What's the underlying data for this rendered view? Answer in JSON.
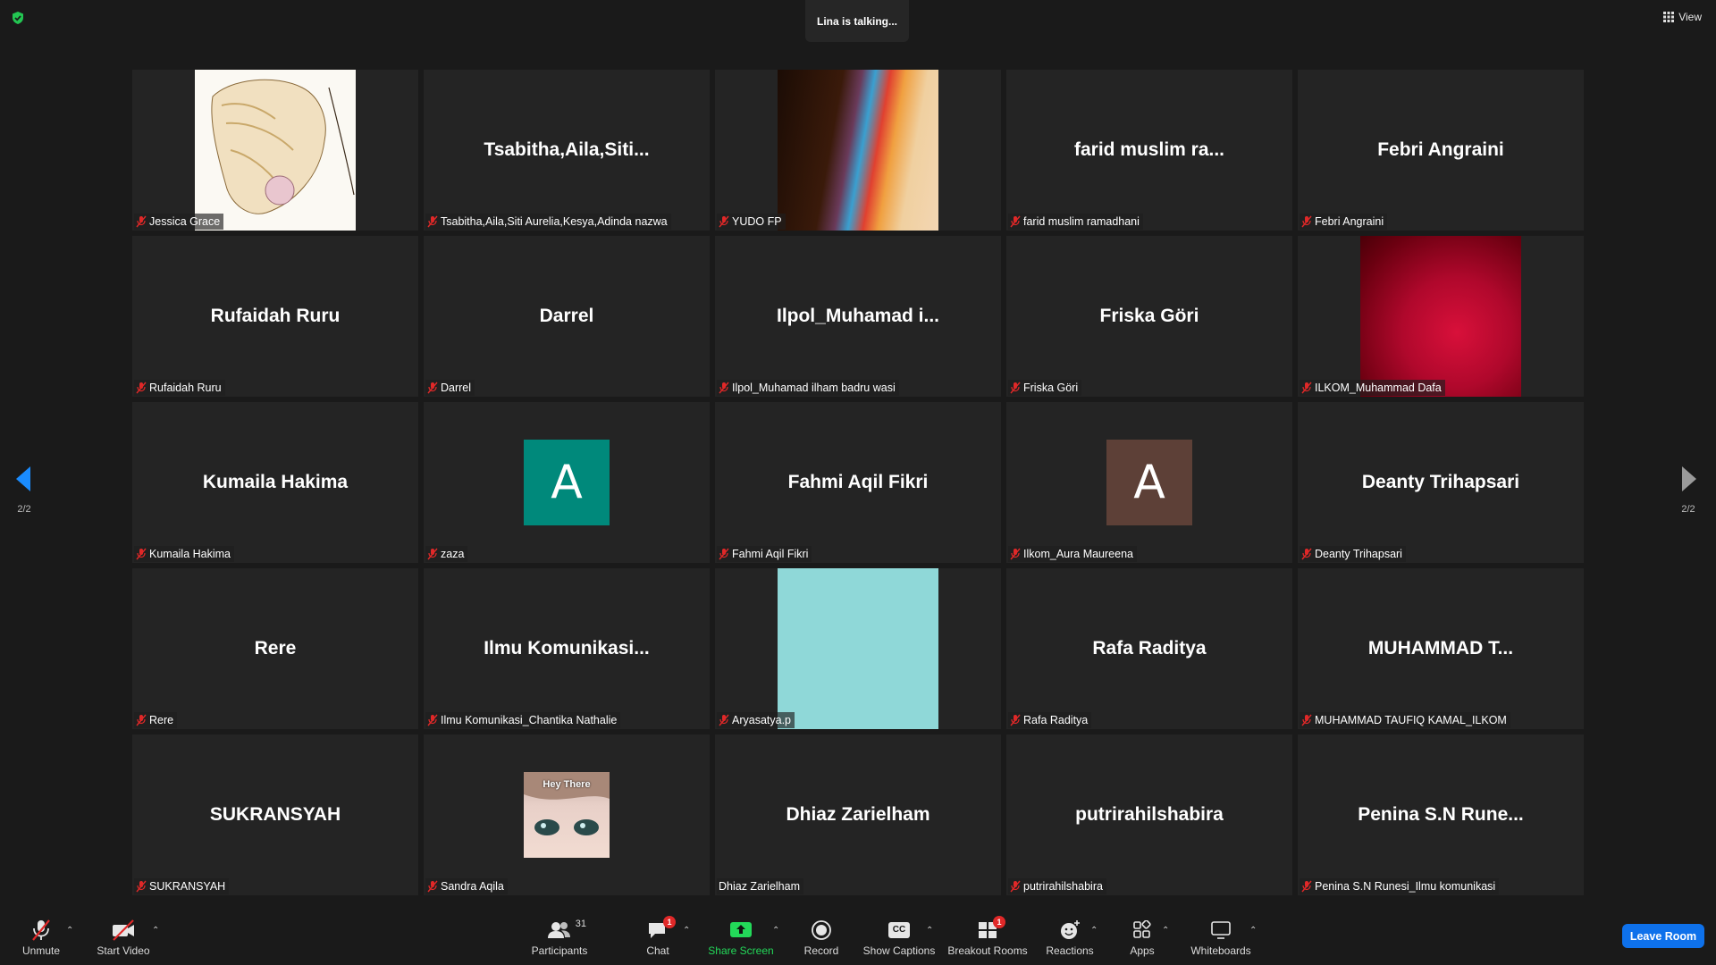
{
  "topbar": {
    "security_icon": "shield-check-icon",
    "talking_indicator": "Lina is talking...",
    "view_label": "View"
  },
  "pagination": {
    "left": "2/2",
    "right": "2/2"
  },
  "tiles": [
    {
      "display": "",
      "label": "Jessica Grace",
      "muted": true
    },
    {
      "display": "Tsabitha,Aila,Siti...",
      "label": "Tsabitha,Aila,Siti Aurelia,Kesya,Adinda nazwa",
      "muted": true
    },
    {
      "display": "",
      "label": "YUDO FP",
      "muted": true
    },
    {
      "display": "farid  muslim  ra...",
      "label": "farid muslim ramadhani",
      "muted": true
    },
    {
      "display": "Febri Angraini",
      "label": "Febri Angraini",
      "muted": true
    },
    {
      "display": "Rufaidah Ruru",
      "label": "Rufaidah Ruru",
      "muted": true
    },
    {
      "display": "Darrel",
      "label": "Darrel",
      "muted": true
    },
    {
      "display": "Ilpol_Muhamad  i...",
      "label": "Ilpol_Muhamad ilham badru wasi",
      "muted": true
    },
    {
      "display": "Friska Göri",
      "label": "Friska Göri",
      "muted": true
    },
    {
      "display": "",
      "label": "ILKOM_Muhammad Dafa",
      "muted": true
    },
    {
      "display": "Kumaila Hakima",
      "label": "Kumaila Hakima",
      "muted": true
    },
    {
      "display": "",
      "avatar": "A",
      "label": "zaza",
      "muted": true
    },
    {
      "display": "Fahmi Aqil Fikri",
      "label": "Fahmi Aqil Fikri",
      "muted": true
    },
    {
      "display": "",
      "avatar": "A",
      "label": "Ilkom_Aura Maureena",
      "muted": true
    },
    {
      "display": "Deanty Trihapsari",
      "label": "Deanty Trihapsari",
      "muted": true
    },
    {
      "display": "Rere",
      "label": "Rere",
      "muted": true
    },
    {
      "display": "Ilmu  Komunikasi...",
      "label": "Ilmu Komunikasi_Chantika Nathalie",
      "muted": true
    },
    {
      "display": "",
      "label": "Aryasatya.p",
      "muted": true
    },
    {
      "display": "Rafa Raditya",
      "label": "Rafa Raditya",
      "muted": true
    },
    {
      "display": "MUHAMMAD  T...",
      "label": "MUHAMMAD TAUFIQ KAMAL_ILKOM",
      "muted": true
    },
    {
      "display": "SUKRANSYAH",
      "label": "SUKRANSYAH",
      "muted": true
    },
    {
      "display": "",
      "image_text": "Hey There",
      "label": "Sandra Aqila",
      "muted": true
    },
    {
      "display": "Dhiaz Zarielham",
      "label": "Dhiaz Zarielham",
      "muted": false
    },
    {
      "display": "putrirahilshabira",
      "label": "putrirahilshabira",
      "muted": true
    },
    {
      "display": "Penina  S.N  Rune...",
      "label": "Penina S.N Runesi_Ilmu komunikasi",
      "muted": true
    }
  ],
  "toolbar": {
    "unmute": "Unmute",
    "start_video": "Start Video",
    "participants": "Participants",
    "participants_count": "31",
    "chat": "Chat",
    "chat_badge": "1",
    "share_screen": "Share Screen",
    "record": "Record",
    "show_captions": "Show Captions",
    "captions_icon_text": "CC",
    "breakout_rooms": "Breakout Rooms",
    "breakout_badge": "1",
    "reactions": "Reactions",
    "apps": "Apps",
    "whiteboards": "Whiteboards",
    "leave": "Leave Room"
  },
  "colors": {
    "background": "#1a1a1a",
    "tile": "#242424",
    "share_green": "#23d959",
    "leave_blue": "#0e71eb",
    "muted_red": "#e02828",
    "avatar_teal": "#00897b",
    "avatar_brown": "#5d4037",
    "nav_blue": "#1a8cff"
  }
}
